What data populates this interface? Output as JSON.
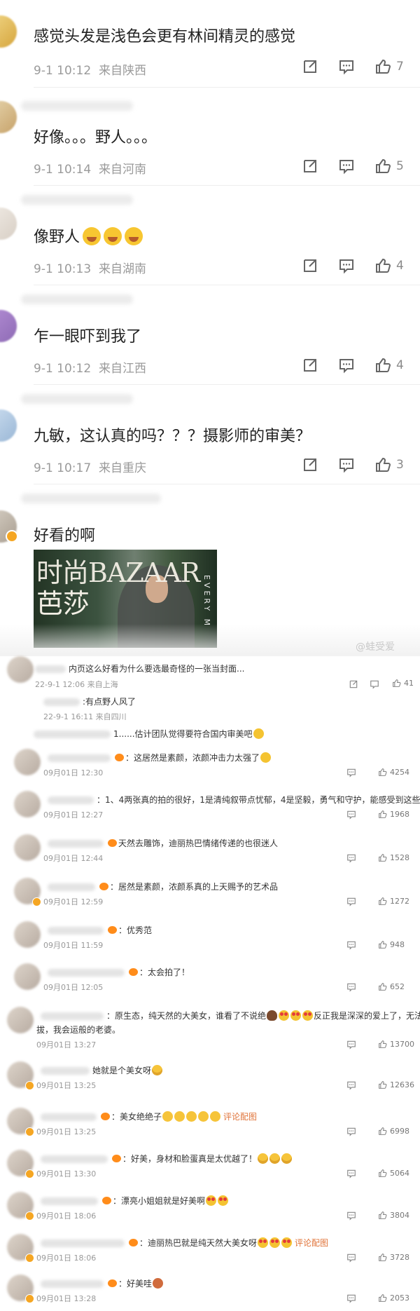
{
  "big_comments": [
    {
      "text": "感觉头发是浅色会更有林间精灵的感觉",
      "time": "9-1 10:12",
      "loc": "来自陕西",
      "likes": "7"
    },
    {
      "text": "好像。。。野人。。。",
      "time": "9-1 10:14",
      "loc": "来自河南",
      "likes": "5"
    },
    {
      "text": "像野人",
      "time": "9-1 10:13",
      "loc": "来自湖南",
      "likes": "4"
    },
    {
      "text": "乍一眼吓到我了",
      "time": "9-1 10:12",
      "loc": "来自江西",
      "likes": "4"
    },
    {
      "text": "九敏，这认真的吗？？？摄影师的审美？",
      "time": "9-1 10:17",
      "loc": "来自重庆",
      "likes": "3"
    },
    {
      "text": "好看的啊"
    }
  ],
  "photo": {
    "mag_line1": "时尚BAZAAR",
    "mag_line2": "芭莎",
    "side": "EVERY M"
  },
  "watermark": "@蛙受爱",
  "post": {
    "text": "内页这么好看为什么要选最奇怪的一张当封面...",
    "time": "22-9-1 12:06 来自上海",
    "likes": "41",
    "reply1": ":有点野人风了",
    "reply1_time": "22-9-1 16:11 来自四川",
    "reply2": "1......估计团队觉得要符合国内审美吧"
  },
  "small_comments": [
    {
      "text": "：这居然是素颜，浓颜冲击力太强了",
      "date": "09月01日",
      "clock": "12:30",
      "likes": "4254"
    },
    {
      "text": "：1、4两张真的拍的很好，1是清纯叙带点忧郁，4是坚毅，勇气和守护，能感受到这些情绪",
      "date": "09月01日",
      "clock": "12:27",
      "likes": "1968"
    },
    {
      "text": "天然去雕饰，迪丽热巴情绪传递的也很迷人",
      "date": "09月01日",
      "clock": "12:44",
      "likes": "1528"
    },
    {
      "text": "：居然是素颜，浓颜系真的上天赐予的艺术品",
      "date": "09月01日",
      "clock": "12:59",
      "likes": "1272"
    },
    {
      "text": "：优秀范",
      "date": "09月01日",
      "clock": "11:59",
      "likes": "948"
    },
    {
      "text": "：太会拍了！",
      "date": "09月01日",
      "clock": "12:05",
      "likes": "652"
    },
    {
      "text": "：原生态，纯天然的大美女，谁看了不说绝",
      "text_b": "反正我是深深的爱上了，无法自",
      "text_c": "拔，我会运般的老婆。",
      "date": "09月01日",
      "clock": "13:27",
      "likes": "13700"
    },
    {
      "text": "她就是个美女呀",
      "date": "09月01日",
      "clock": "13:25",
      "likes": "12636"
    },
    {
      "text": "：美女绝绝子",
      "tag": "评论配图",
      "date": "09月01日",
      "clock": "13:25",
      "likes": "6998"
    },
    {
      "text": "：好美，身材和脸蛋真是太优越了！",
      "date": "09月01日",
      "clock": "13:30",
      "likes": "5064"
    },
    {
      "text": "：漂亮小姐姐就是好美啊",
      "date": "09月01日",
      "clock": "18:06",
      "likes": "3804"
    },
    {
      "text": "：迪丽热巴就是纯天然大美女呀",
      "tag": "评论配图",
      "date": "09月01日",
      "clock": "18:06",
      "likes": "3728"
    },
    {
      "text": "：好美哇",
      "date": "09月01日",
      "clock": "13:28",
      "likes": "2053"
    }
  ],
  "icons": {
    "share": "share-icon",
    "comment": "comment-icon",
    "like": "thumbs-up-icon"
  }
}
